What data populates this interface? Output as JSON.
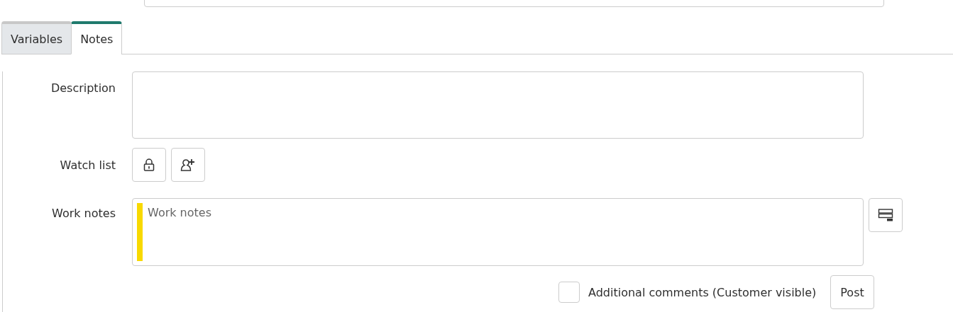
{
  "tabs": [
    {
      "label": "Variables",
      "selected": false
    },
    {
      "label": "Notes",
      "selected": true
    }
  ],
  "description": {
    "label": "Description"
  },
  "watch_list": {
    "label": "Watch list"
  },
  "work_notes": {
    "label": "Work notes",
    "placeholder": "Work notes"
  },
  "additional_comments": {
    "label": "Additional comments (Customer visible)",
    "checked": false
  },
  "post_button": "Post"
}
